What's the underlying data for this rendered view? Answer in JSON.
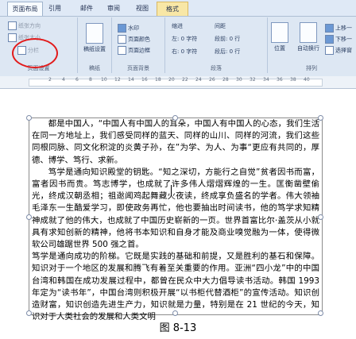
{
  "tabs": [
    "页面布局",
    "引用",
    "邮件",
    "审阅",
    "视图",
    "格式"
  ],
  "ribbon": {
    "page_setup": {
      "text_direction": "纸张方向",
      "size": "纸张大小",
      "columns": "分栏",
      "label": "页面设置"
    },
    "manuscript": {
      "label": "稿纸",
      "button": "稿纸设置"
    },
    "page_background": {
      "watermark": "水印",
      "page_color": "页面颜色",
      "page_border": "页面边框",
      "label": "页面背景"
    },
    "paragraph": {
      "indent": "缩进",
      "left_label": "左:",
      "left_value": "0 字符",
      "right_label": "右:",
      "right_value": "0 字符",
      "spacing": "间距",
      "before_label": "段前:",
      "before_value": "0 行",
      "after_label": "段后:",
      "after_value": "0 行",
      "label": "段落"
    },
    "arrange": {
      "position": "位置",
      "wrap": "自动换行",
      "bring_forward": "上移一",
      "send_backward": "下移一",
      "selection_pane": "选择窗",
      "label": "排列"
    }
  },
  "ruler_numbers": [
    "2",
    "4",
    "6",
    "8",
    "10",
    "12",
    "14",
    "16",
    "18",
    "20",
    "22",
    "24",
    "26",
    "28",
    "30",
    "32",
    "34",
    "36",
    "38",
    "40"
  ],
  "document": {
    "paragraphs": [
      "都是中国人，“中国人有中国人的耳朵，中国人有中国人的心态，我们生活在同一方地址上，我们感受同样的蓝天、同样的山川、同样的河流，我们这些同根同脉、同文化积淀的炎黄子孙，在”为学、为人、为事“更应有共同的，厚德、博学、笃行、求新。",
      "笃学是通向知识殿堂的钥匙。“知之深切，方能行之自觉”贫者因书而富，富者因书而贵。笃志博学，也成就了许多伟人熠熠辉煌的一生。匡衡凿壁偷光，终成汉朝丞相；祖逖闻鸡起舞藏火夜读，终成享负盛名的学者。伟大领袖毛泽东一生酷爱学习，即使政务再忙，他也要抽出时间读书，他的笃学求知精神成就了他的伟大，也成就了中国历史崭新的一页。世界首富比尔·盖茨从小就具有求知创新的精神，他将书本知识和自身才能及商业嗅觉融为一体，使得微软公司雄踞世界 500 强之首。",
      "笃学是通向成功的阶梯。它既是实践的基础和前提，又是胜利的基石和保障。知识对于一个地区的发展和腾飞有着至关重要的作用。亚洲“四小龙”中的中国台湾和韩国在成功发展过程中，都曾在民众中大力倡导读书活动。韩国 1993 年定为“读书年”，中国台湾则积极开展“以书柜代替酒柜”的宣传活动。知识创造财富，知识创造先进生产力，知识就是力量，特别是在 21 世纪的今天，知识对于人类社会的发展和人类文明"
    ]
  },
  "caption": "图 8-13"
}
